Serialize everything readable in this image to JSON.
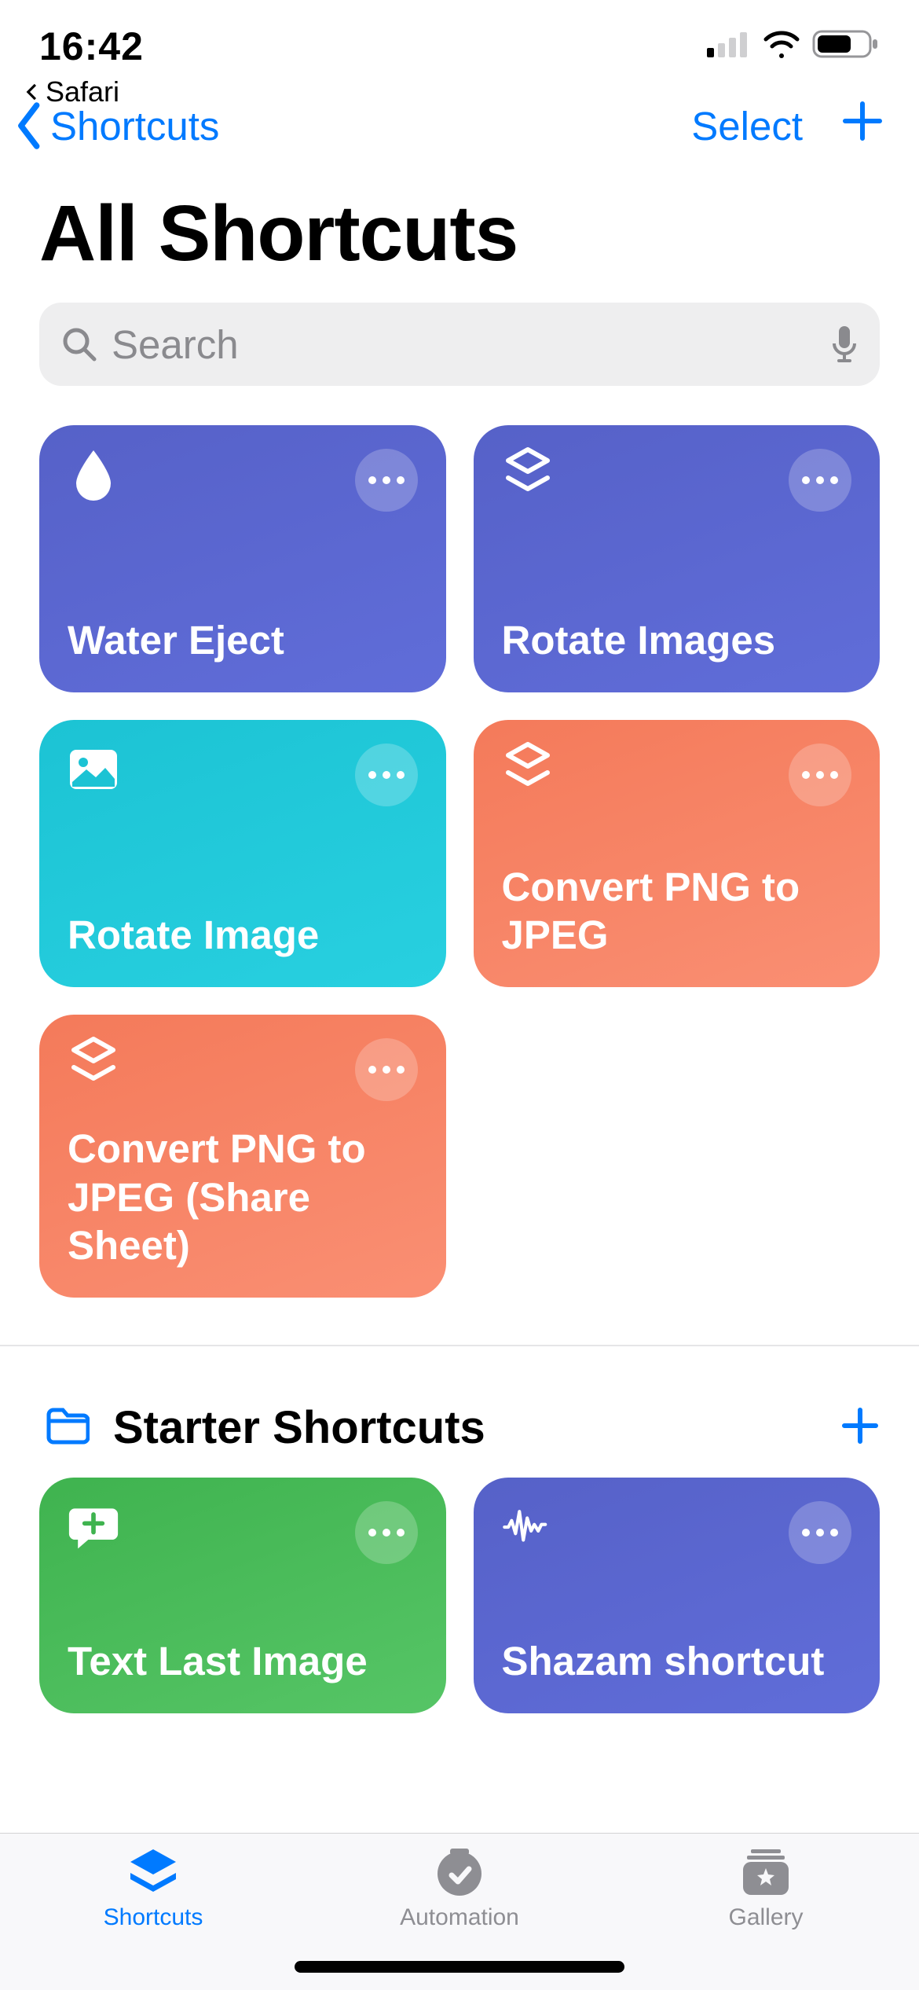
{
  "status": {
    "time": "16:42",
    "back_app": "Safari"
  },
  "nav": {
    "back_label": "Shortcuts",
    "select_label": "Select"
  },
  "title": "All Shortcuts",
  "search": {
    "placeholder": "Search"
  },
  "tiles": [
    {
      "label": "Water Eject",
      "icon": "drop",
      "color": "g-blue"
    },
    {
      "label": "Rotate Images",
      "icon": "layers",
      "color": "g-blue"
    },
    {
      "label": "Rotate Image",
      "icon": "picture",
      "color": "g-cyan"
    },
    {
      "label": "Convert PNG to JPEG",
      "icon": "layers",
      "color": "g-orange"
    },
    {
      "label": "Convert PNG to JPEG (Share Sheet)",
      "icon": "layers",
      "color": "g-orange"
    }
  ],
  "folder": {
    "title": "Starter Shortcuts"
  },
  "starter_tiles": [
    {
      "label": "Text Last Image",
      "icon": "chat-plus",
      "color": "g-green"
    },
    {
      "label": "Shazam shortcut",
      "icon": "waveform",
      "color": "g-blue"
    }
  ],
  "tabs": [
    {
      "label": "Shortcuts",
      "active": true
    },
    {
      "label": "Automation",
      "active": false
    },
    {
      "label": "Gallery",
      "active": false
    }
  ]
}
